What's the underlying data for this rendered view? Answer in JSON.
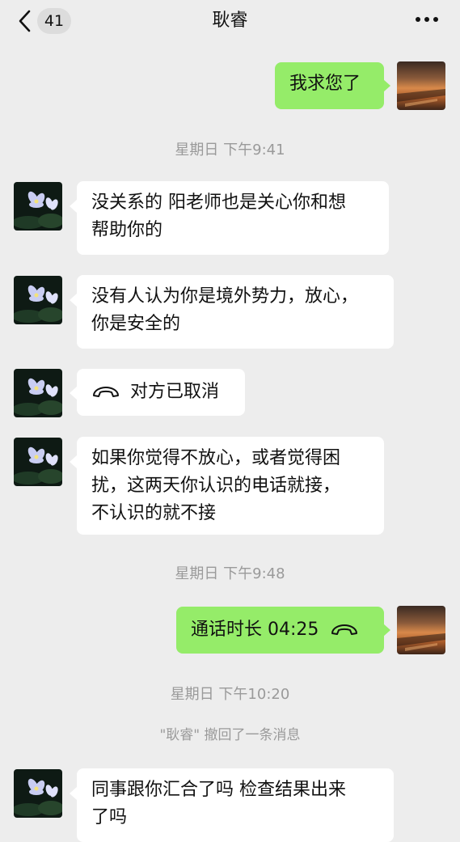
{
  "header": {
    "back_icon": "chevron-left-icon",
    "unread_count": "41",
    "title": "耿睿",
    "more_icon": "more-dots-icon"
  },
  "messages": [
    {
      "side": "right",
      "text": "我求您了"
    },
    {
      "type": "time",
      "text": "星期日 下午9:41"
    },
    {
      "side": "left",
      "text": "没关系的 阳老师也是关心你和想\n帮助你的"
    },
    {
      "side": "left",
      "text": "没有人认为你是境外势力，放心，\n你是安全的"
    },
    {
      "side": "left",
      "type": "call",
      "icon": "phone-hangup-icon",
      "text": "对方已取消"
    },
    {
      "side": "left",
      "text": "如果你觉得不放心，或者觉得困\n扰，这两天你认识的电话就接，\n不认识的就不接"
    },
    {
      "type": "time",
      "text": "星期日 下午9:48"
    },
    {
      "side": "right",
      "type": "call",
      "icon": "phone-hangup-icon",
      "text": "通话时长 04:25"
    },
    {
      "type": "time",
      "text": "星期日 下午10:20"
    },
    {
      "type": "system",
      "text": "\"耿睿\" 撤回了一条消息"
    },
    {
      "side": "left",
      "text": "同事跟你汇合了吗  检查结果出来\n了吗"
    }
  ],
  "colors": {
    "background": "#ededed",
    "incoming_bubble": "#ffffff",
    "outgoing_bubble": "#95ec69",
    "timestamp_text": "#9a9a9a"
  }
}
